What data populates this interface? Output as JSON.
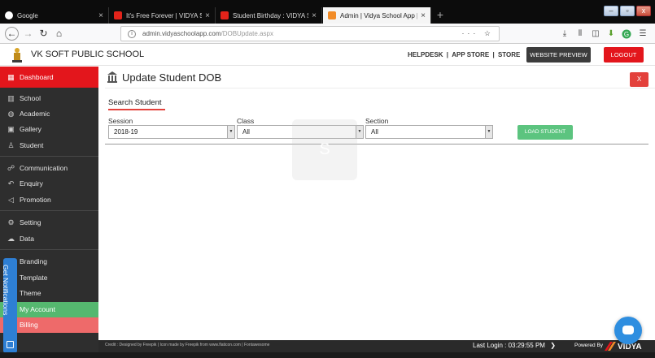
{
  "browser": {
    "tabs": [
      {
        "title": "Google",
        "color": "#4285f4"
      },
      {
        "title": "It's Free Forever | VIDYA School",
        "color": "#e2231a"
      },
      {
        "title": "Student Birthday : VIDYA SCHO",
        "color": "#e2231a"
      },
      {
        "title": "Admin | Vidya School App | It c",
        "color": "#f28c28"
      }
    ],
    "new_tab": "+",
    "tab_close": "×",
    "url": "admin.vidyaschoolapp.com",
    "url_path": "/DOBUpdate.aspx",
    "url_actions": "··· ☆",
    "window_controls": [
      "–",
      "▫",
      "x"
    ]
  },
  "header": {
    "school_name": "VK SOFT PUBLIC SCHOOL",
    "links": [
      "HELPDESK",
      "APP STORE",
      "STORE"
    ],
    "separator": "|",
    "website_preview": "WEBSITE PREVIEW",
    "logout": "LOGOUT"
  },
  "sidebar": {
    "dashboard": "Dashboard",
    "items": [
      {
        "label": "School",
        "icon": "building-icon"
      },
      {
        "label": "Academic",
        "icon": "globe-icon"
      },
      {
        "label": "Gallery",
        "icon": "image-icon"
      },
      {
        "label": "Student",
        "icon": "student-icon"
      },
      {
        "label": "Communication",
        "icon": "communication-icon"
      },
      {
        "label": "Enquiry",
        "icon": "reply-icon"
      },
      {
        "label": "Promotion",
        "icon": "megaphone-icon"
      },
      {
        "label": "Setting",
        "icon": "gear-icon"
      },
      {
        "label": "Data",
        "icon": "cloud-icon"
      },
      {
        "label": "Branding",
        "icon": ""
      },
      {
        "label": "Template",
        "icon": ""
      },
      {
        "label": "Theme",
        "icon": ""
      },
      {
        "label": "My Account",
        "icon": ""
      },
      {
        "label": "Billing",
        "icon": ""
      }
    ],
    "notifications_tab": "Get Notifications"
  },
  "main": {
    "page_title": "Update Student DOB",
    "close_label": "X",
    "section_title": "Search Student",
    "session": {
      "label": "Session",
      "value": "2018-19"
    },
    "class": {
      "label": "Class",
      "value": "All"
    },
    "section": {
      "label": "Section",
      "value": "All"
    },
    "load_button": "LOAD STUDENT",
    "watermark": "S"
  },
  "footer": {
    "credit": "Credit : Designed by Freepik | Icon made by Freepik from www.flaticon.com | Fontawesome",
    "last_login": "Last Login : 03:29:55 PM",
    "powered_by": "Powered By",
    "brand": "VIDYA"
  },
  "colors": {
    "accent_red": "#e3161c",
    "accent_green": "#5cc47f",
    "sidebar_bg": "#2e2e2e",
    "notif_blue": "#2e7fd4"
  }
}
